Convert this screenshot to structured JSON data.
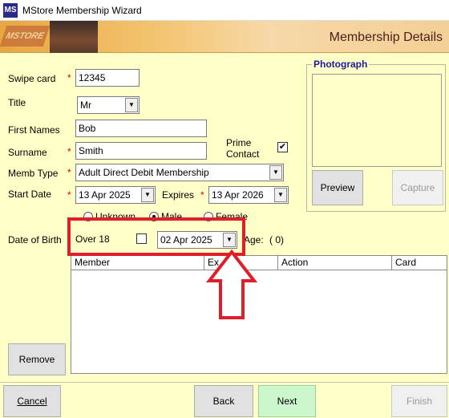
{
  "window": {
    "title": "MStore Membership Wizard",
    "app_icon": "MS"
  },
  "banner": {
    "title": "Membership Details",
    "logo_text": "MSTORE"
  },
  "form": {
    "swipe_card": {
      "label": "Swipe card",
      "value": "12345"
    },
    "title": {
      "label": "Title",
      "value": "Mr"
    },
    "first_names": {
      "label": "First Names",
      "value": "Bob"
    },
    "surname": {
      "label": "Surname",
      "value": "Smith"
    },
    "prime_contact": {
      "label": "Prime Contact",
      "checked": true,
      "check_glyph": "✔"
    },
    "memb_type": {
      "label": "Memb Type",
      "value": "Adult Direct Debit Membership"
    },
    "start_date": {
      "label": "Start Date",
      "value": "13  Apr  2025"
    },
    "expires": {
      "label": "Expires",
      "value": "13  Apr  2026"
    },
    "gender": {
      "options": [
        "Unknown",
        "Male",
        "Female"
      ],
      "selected": "Male"
    },
    "dob": {
      "label": "Date of Birth",
      "over18_label": "Over 18",
      "over18_checked": false,
      "value": "02  Apr  2025"
    },
    "age": {
      "label": "Age:",
      "value": "( 0)"
    },
    "required_mark": "*"
  },
  "photo": {
    "legend": "Photograph",
    "preview_label": "Preview",
    "capture_label": "Capture"
  },
  "members_grid": {
    "columns": [
      "Member",
      "Ex...",
      "Action",
      "Card"
    ]
  },
  "buttons": {
    "remove": "Remove",
    "cancel": "Cancel",
    "back": "Back",
    "next": "Next",
    "finish": "Finish"
  },
  "colors": {
    "background": "#ffffc8",
    "annotation": "#e01e2a",
    "required": "#e00000",
    "legend": "#1a1aa0"
  }
}
